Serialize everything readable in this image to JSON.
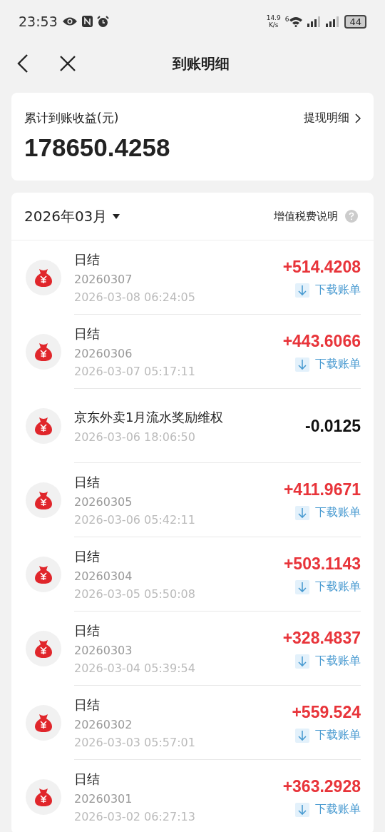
{
  "status_bar": {
    "time": "23:53",
    "speed": "14.9",
    "speed_unit": "K/s",
    "wifi_badge": "6",
    "battery": "44"
  },
  "header": {
    "title": "到账明细"
  },
  "summary": {
    "label": "累计到账收益(元)",
    "link": "提现明细",
    "total": "178650.4258"
  },
  "list": {
    "month": "2026年03月",
    "tax_note": "增值税费说明",
    "rows": [
      {
        "kind": "income",
        "title": "日结",
        "code": "20260307",
        "time": "2026-03-08 06:24:05",
        "amount": "+514.4208",
        "download": "下载账单"
      },
      {
        "kind": "income",
        "title": "日结",
        "code": "20260306",
        "time": "2026-03-07 05:17:11",
        "amount": "+443.6066",
        "download": "下载账单"
      },
      {
        "kind": "deduction",
        "title": "京东外卖1月流水奖励维权",
        "time": "2026-03-06 18:06:50",
        "amount": "-0.0125"
      },
      {
        "kind": "income",
        "title": "日结",
        "code": "20260305",
        "time": "2026-03-06 05:42:11",
        "amount": "+411.9671",
        "download": "下载账单"
      },
      {
        "kind": "income",
        "title": "日结",
        "code": "20260304",
        "time": "2026-03-05 05:50:08",
        "amount": "+503.1143",
        "download": "下载账单"
      },
      {
        "kind": "income",
        "title": "日结",
        "code": "20260303",
        "time": "2026-03-04 05:39:54",
        "amount": "+328.4837",
        "download": "下载账单"
      },
      {
        "kind": "income",
        "title": "日结",
        "code": "20260302",
        "time": "2026-03-03 05:57:01",
        "amount": "+559.524",
        "download": "下载账单"
      },
      {
        "kind": "income",
        "title": "日结",
        "code": "20260301",
        "time": "2026-03-02 06:27:13",
        "amount": "+363.2928",
        "download": "下载账单"
      }
    ]
  }
}
